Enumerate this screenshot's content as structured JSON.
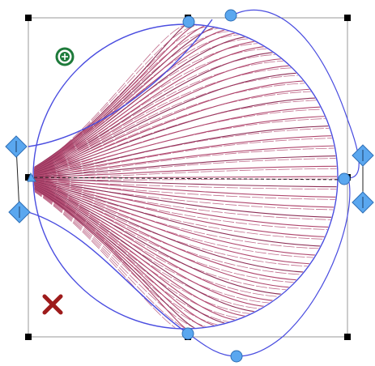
{
  "colors": {
    "background": "#ffffff",
    "stitch": "#b0476e",
    "stitch_dark": "#8e2f57",
    "outline": "#4a4de0",
    "bounding_box": "#9a9a9a",
    "handle_fill": "#5aa7ef",
    "handle_stroke": "#2f6fb6",
    "pivot": "#1d7a3a",
    "delete": "#9e1b1b",
    "selection_handle": "#000000"
  },
  "icons": {
    "pivot": "rotation-pivot-icon",
    "delete": "delete-x-icon",
    "diamond": "diamond-handle-icon",
    "circle": "control-point-icon"
  },
  "object": {
    "shape": "circle",
    "fill_type": "fan-curved-satin",
    "selected": true
  }
}
